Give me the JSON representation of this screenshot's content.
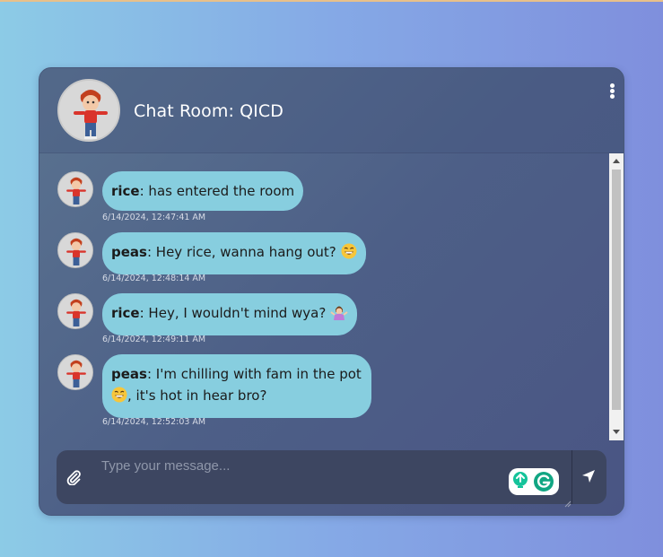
{
  "room": {
    "title": "Chat Room: QICD"
  },
  "messages": [
    {
      "user": "rice",
      "text": ": has entered the room",
      "emoji": "",
      "timestamp": "6/14/2024, 12:47:41 AM"
    },
    {
      "user": "peas",
      "text": ": Hey rice, wanna hang out? ",
      "emoji": "grinning-sweat",
      "timestamp": "6/14/2024, 12:48:14 AM"
    },
    {
      "user": "rice",
      "text": ": Hey, I wouldn't mind wya? ",
      "emoji": "person-shrugging",
      "timestamp": "6/14/2024, 12:49:11 AM"
    },
    {
      "user": "peas",
      "text": ": I'm chilling with fam in the pot ",
      "text2": ", it's hot in hear bro?",
      "emoji": "grinning-sweat",
      "timestamp": "6/14/2024, 12:52:03 AM"
    }
  ],
  "composer": {
    "placeholder": "Type your message..."
  },
  "icons": {
    "more": "more-vertical-icon",
    "attach": "paperclip-icon",
    "send": "send-arrow-icon",
    "grammarly": "grammarly-icon"
  },
  "colors": {
    "bubble": "#87cedf",
    "window": "#4d5f87",
    "input_bar": "#3d4661",
    "background_left": "#8ccbe6",
    "background_right": "#7f8fdd"
  }
}
